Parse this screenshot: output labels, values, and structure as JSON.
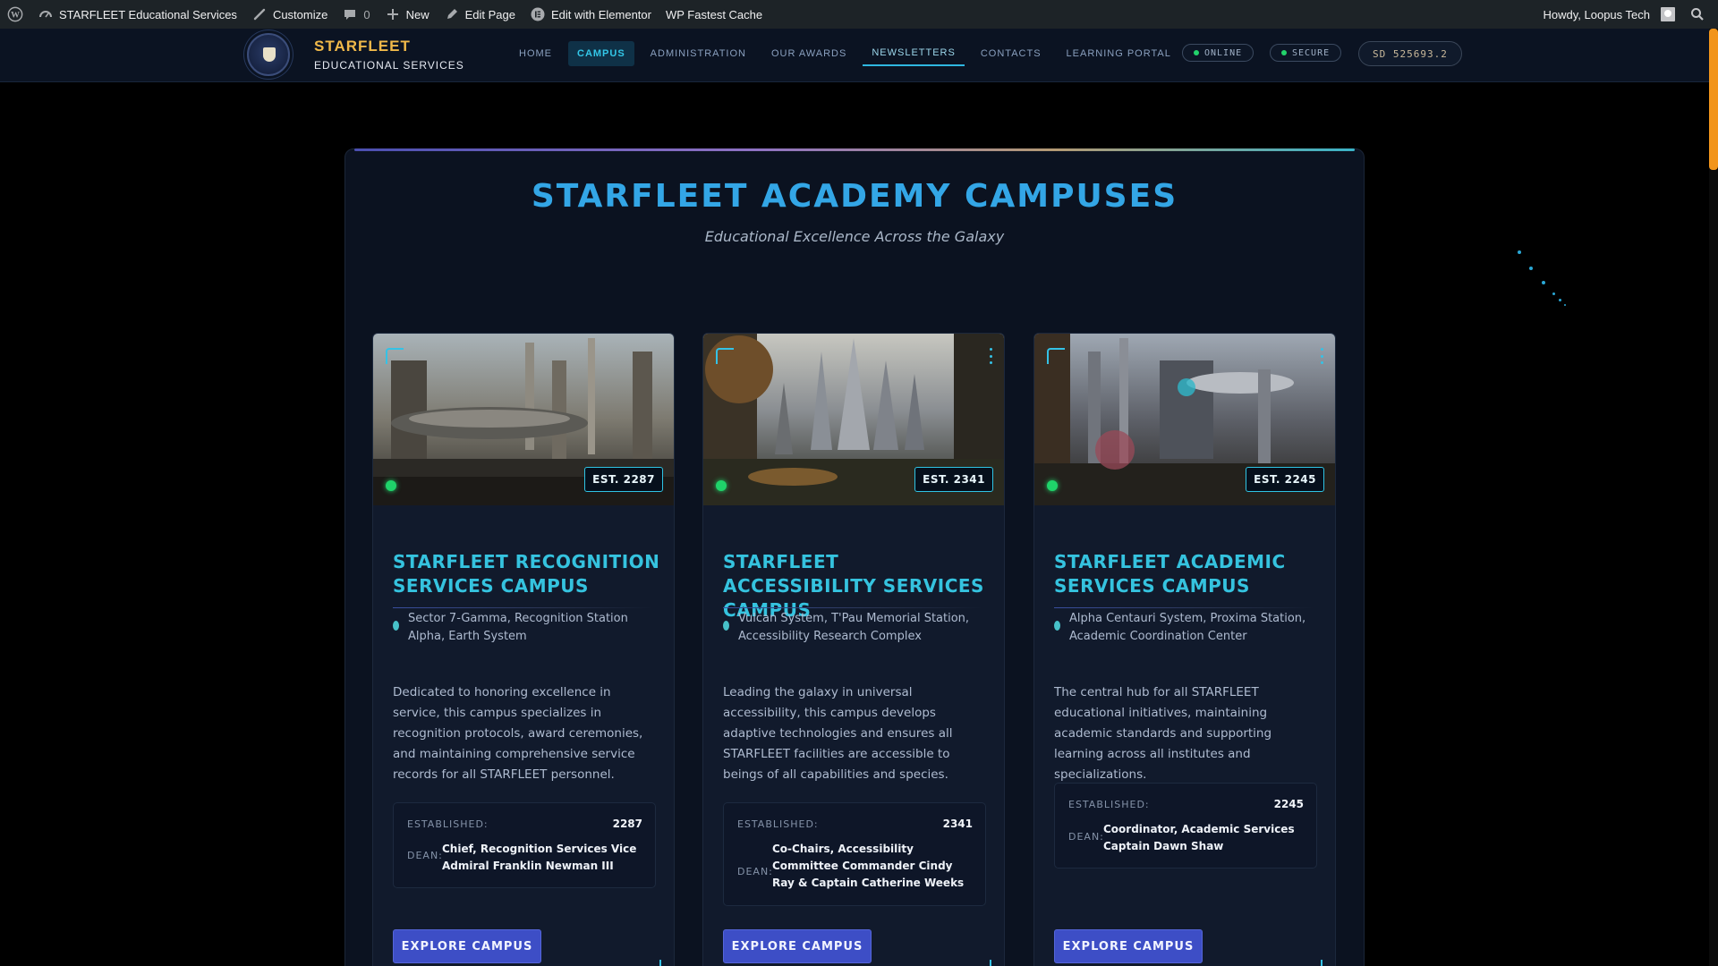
{
  "admin_bar": {
    "site_name": "STARFLEET Educational Services",
    "customize": "Customize",
    "comments_count": "0",
    "new": "New",
    "edit_page": "Edit Page",
    "edit_elementor": "Edit with Elementor",
    "fastest_cache": "WP Fastest Cache",
    "howdy": "Howdy, Loopus Tech"
  },
  "header": {
    "brand_line1": "STARFLEET",
    "brand_line2": "EDUCATIONAL SERVICES",
    "nav": [
      {
        "label": "HOME",
        "state": "normal"
      },
      {
        "label": "CAMPUS",
        "state": "active"
      },
      {
        "label": "ADMINISTRATION",
        "state": "normal"
      },
      {
        "label": "OUR AWARDS",
        "state": "normal"
      },
      {
        "label": "NEWSLETTERS",
        "state": "hover"
      },
      {
        "label": "CONTACTS",
        "state": "normal"
      },
      {
        "label": "LEARNING PORTAL",
        "state": "normal"
      }
    ],
    "status_online": "ONLINE",
    "status_secure": "SECURE",
    "stardate": "SD 525693.2"
  },
  "page": {
    "title": "STARFLEET ACADEMY CAMPUSES",
    "subtitle": "Educational Excellence Across the Galaxy"
  },
  "campuses": [
    {
      "badge": "EST. 2287",
      "title": "STARFLEET RECOGNITION SERVICES CAMPUS",
      "location": "Sector 7-Gamma, Recognition Station Alpha, Earth System",
      "description": "Dedicated to honoring excellence in service, this campus specializes in recognition protocols, award ceremonies, and maintaining comprehensive service records for all STARFLEET personnel.",
      "established_label": "ESTABLISHED:",
      "established": "2287",
      "dean_label": "DEAN:",
      "dean": "Chief, Recognition Services Vice Admiral Franklin Newman III",
      "button": "EXPLORE CAMPUS"
    },
    {
      "badge": "EST. 2341",
      "title": "STARFLEET ACCESSIBILITY SERVICES CAMPUS",
      "location": "Vulcan System, T'Pau Memorial Station, Accessibility Research Complex",
      "description": "Leading the galaxy in universal accessibility, this campus develops adaptive technologies and ensures all STARFLEET facilities are accessible to beings of all capabilities and species.",
      "established_label": "ESTABLISHED:",
      "established": "2341",
      "dean_label": "DEAN:",
      "dean": "Co-Chairs, Accessibility Committee Commander Cindy Ray & Captain Catherine Weeks",
      "button": "EXPLORE CAMPUS"
    },
    {
      "badge": "EST. 2245",
      "title": "STARFLEET ACADEMIC SERVICES CAMPUS",
      "location": "Alpha Centauri System, Proxima Station, Academic Coordination Center",
      "description": "The central hub for all STARFLEET educational initiatives, maintaining academic standards and supporting learning across all institutes and specializations.",
      "established_label": "ESTABLISHED:",
      "established": "2245",
      "dean_label": "DEAN:",
      "dean": "Coordinator, Academic Services Captain Dawn Shaw",
      "button": "EXPLORE CAMPUS"
    }
  ],
  "colors": {
    "accent": "#33a6e6",
    "brand_gold": "#f0b94a",
    "button": "#3d4ec6",
    "status_green": "#22d36b",
    "scroll_thumb": "#f2951b"
  }
}
